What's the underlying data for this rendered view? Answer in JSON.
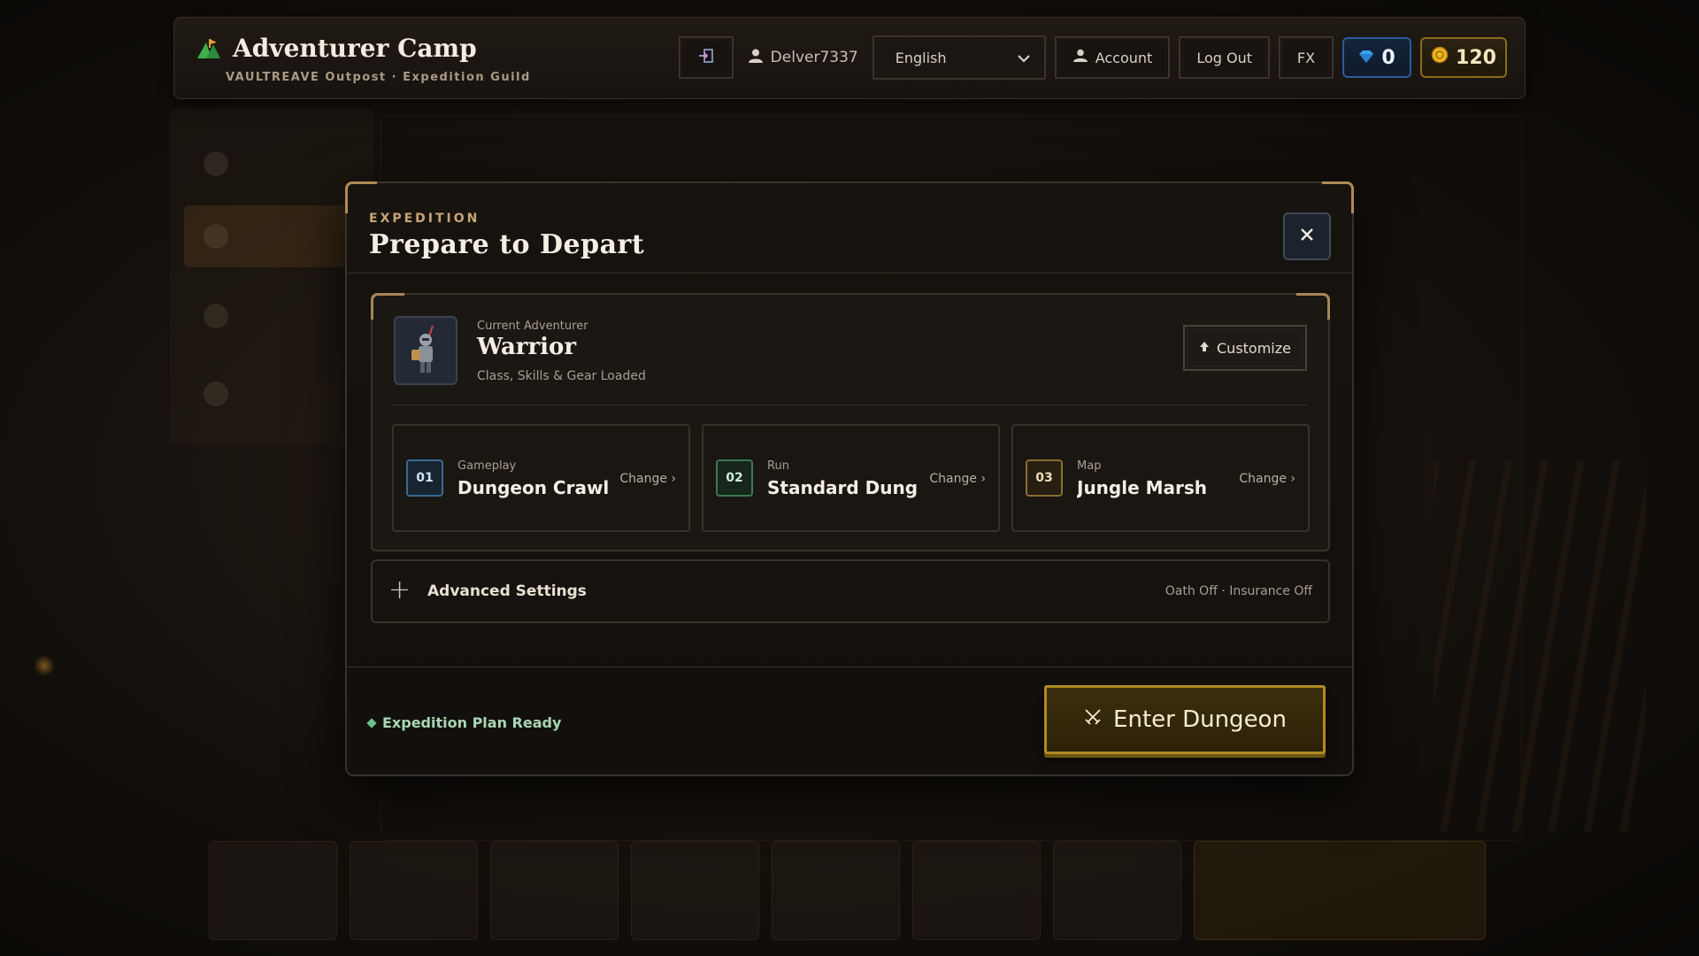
{
  "header": {
    "title": "Adventurer Camp",
    "subtitle": "VAULTREAVE Outpost · Expedition Guild",
    "username": "Delver7337",
    "language": "English",
    "account_label": "Account",
    "logout_label": "Log Out",
    "fx_label": "FX",
    "gems": "0",
    "coins": "120",
    "colors": {
      "gem": "#2a5c9c",
      "coin": "#b08a22",
      "brand_icon": "#3fae4a"
    }
  },
  "modal": {
    "eyebrow": "EXPEDITION",
    "title": "Prepare to Depart",
    "adventurer": {
      "label": "Current Adventurer",
      "name": "Warrior",
      "subtitle": "Class, Skills & Gear Loaded",
      "customize_label": "Customize"
    },
    "options": [
      {
        "number": "01",
        "category": "Gameplay",
        "value": "Dungeon Crawl",
        "change_label": "Change ›"
      },
      {
        "number": "02",
        "category": "Run",
        "value": "Standard Dung...",
        "change_label": "Change ›"
      },
      {
        "number": "03",
        "category": "Map",
        "value": "Jungle Marsh",
        "change_label": "Change ›"
      }
    ],
    "advanced": {
      "title": "Advanced Settings",
      "status": "Oath Off · Insurance Off"
    },
    "status_text": "Expedition Plan Ready",
    "enter_label": "Enter Dungeon"
  }
}
